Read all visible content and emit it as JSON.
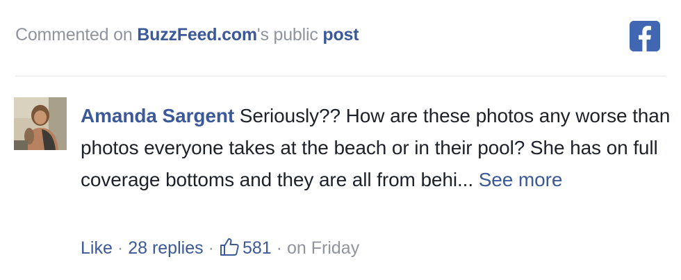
{
  "header": {
    "prefix": "Commented on ",
    "page_name": "BuzzFeed.com",
    "middle": "'s public ",
    "post_link": "post",
    "logo_icon": "facebook-icon",
    "brand_color": "#3b5998"
  },
  "comment": {
    "author": "Amanda Sargent",
    "text": " Seriously?? How are these photos any worse than photos everyone takes at the beach or in their pool? She has on full coverage bottoms and they are all from behi... ",
    "see_more": "See more",
    "avatar_icon": "profile-photo"
  },
  "actions": {
    "like_label": "Like",
    "separator": "·",
    "replies": "28 replies",
    "like_icon": "thumbs-up-icon",
    "like_count": "581",
    "timestamp": "on Friday"
  }
}
